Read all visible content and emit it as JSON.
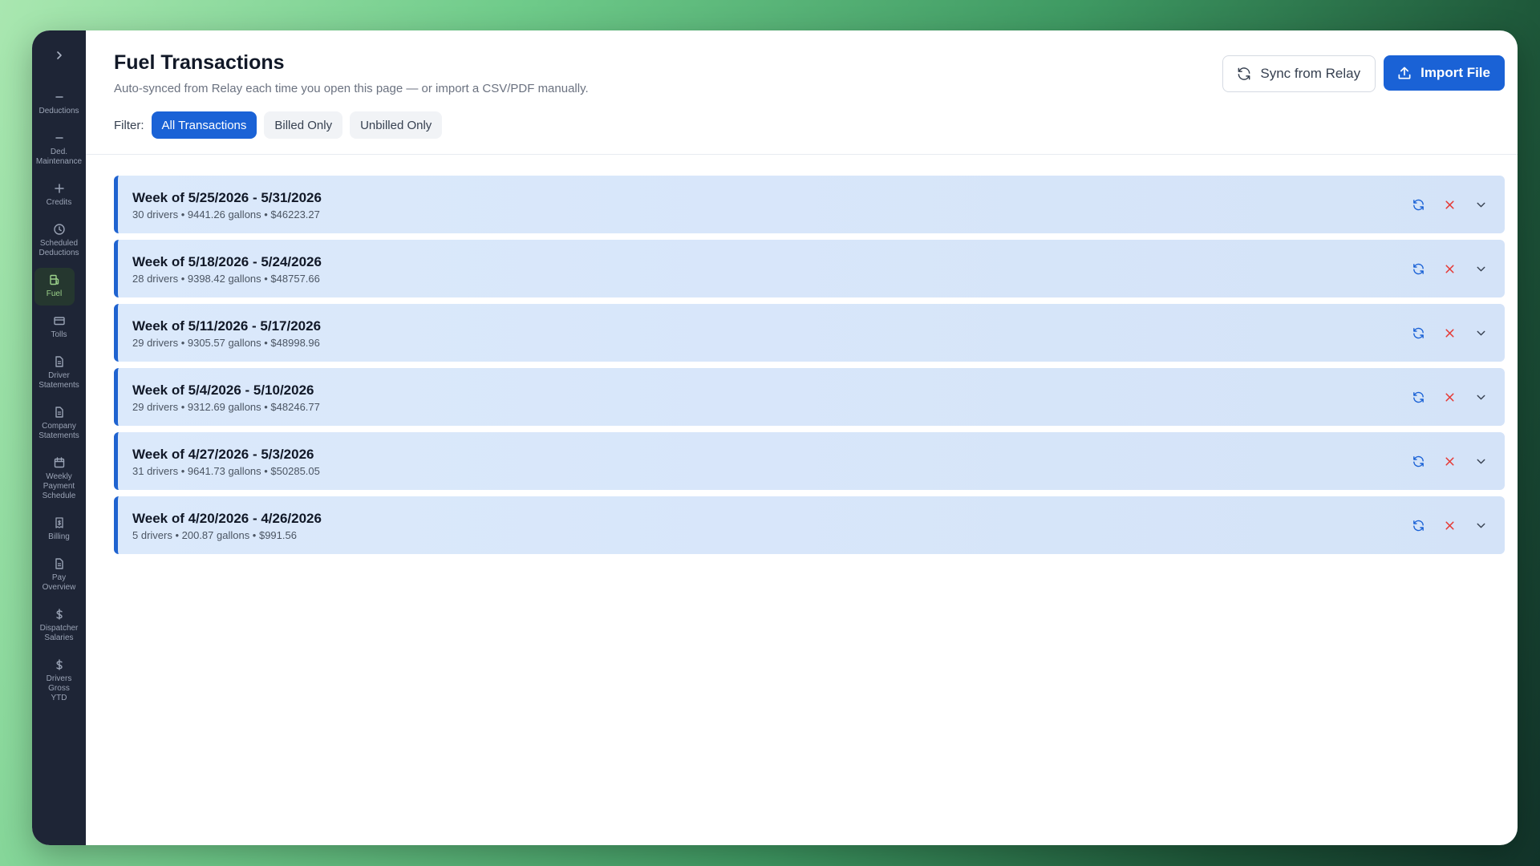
{
  "sidebar": {
    "items": [
      {
        "label": "Deductions",
        "icon": "minus-icon"
      },
      {
        "label": "Ded.\nMaintenance",
        "icon": "minus-icon"
      },
      {
        "label": "Credits",
        "icon": "plus-icon"
      },
      {
        "label": "Scheduled\nDeductions",
        "icon": "clock-icon"
      },
      {
        "label": "Fuel",
        "icon": "fuel-icon",
        "active": true
      },
      {
        "label": "Tolls",
        "icon": "credit-card-icon"
      },
      {
        "label": "Driver\nStatements",
        "icon": "document-icon"
      },
      {
        "label": "Company\nStatements",
        "icon": "document-icon"
      },
      {
        "label": "Weekly\nPayment\nSchedule",
        "icon": "calendar-icon"
      },
      {
        "label": "Billing",
        "icon": "receipt-icon"
      },
      {
        "label": "Pay\nOverview",
        "icon": "document-icon"
      },
      {
        "label": "Dispatcher\nSalaries",
        "icon": "dollar-icon"
      },
      {
        "label": "Drivers\nGross\nYTD",
        "icon": "dollar-icon"
      }
    ]
  },
  "header": {
    "title": "Fuel Transactions",
    "subtitle": "Auto-synced from Relay each time you open this page — or import a CSV/PDF manually.",
    "sync_label": "Sync from Relay",
    "import_label": "Import File",
    "filter_label": "Filter:",
    "filters": [
      {
        "label": "All Transactions",
        "active": true
      },
      {
        "label": "Billed Only",
        "active": false
      },
      {
        "label": "Unbilled Only",
        "active": false
      }
    ]
  },
  "weeks": [
    {
      "title": "Week of 5/25/2026 - 5/31/2026",
      "summary": "30 drivers • 9441.26 gallons • $46223.27"
    },
    {
      "title": "Week of 5/18/2026 - 5/24/2026",
      "summary": "28 drivers • 9398.42 gallons • $48757.66"
    },
    {
      "title": "Week of 5/11/2026 - 5/17/2026",
      "summary": "29 drivers • 9305.57 gallons • $48998.96"
    },
    {
      "title": "Week of 5/4/2026 - 5/10/2026",
      "summary": "29 drivers • 9312.69 gallons • $48246.77"
    },
    {
      "title": "Week of 4/27/2026 - 5/3/2026",
      "summary": "31 drivers • 9641.73 gallons • $50285.05"
    },
    {
      "title": "Week of 4/20/2026 - 4/26/2026",
      "summary": "5 drivers • 200.87 gallons • $991.56"
    }
  ],
  "colors": {
    "accent": "#1a62d6",
    "delete": "#e53935",
    "sidebar_bg": "#1e2536",
    "active_nav": "#9bd18a"
  }
}
